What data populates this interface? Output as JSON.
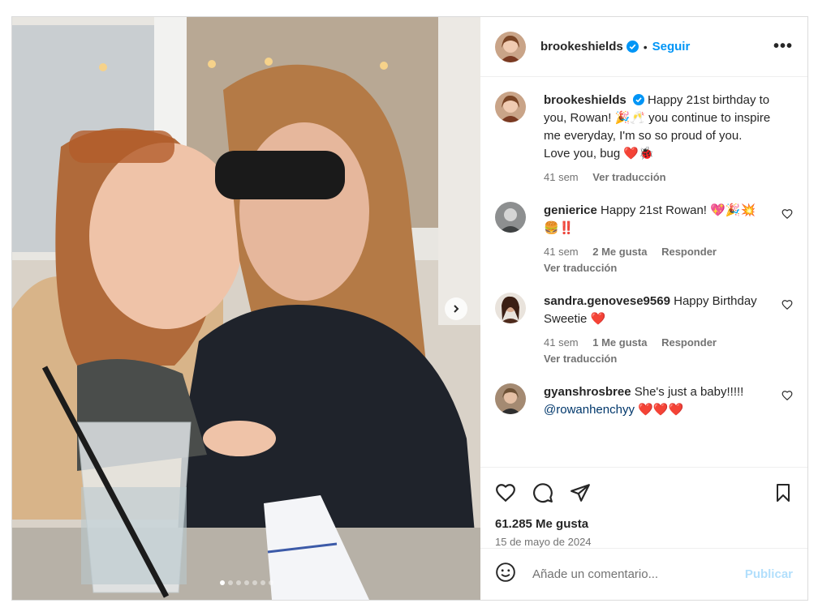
{
  "post": {
    "username": "brookeshields",
    "dot": "•",
    "follow_label": "Seguir",
    "more_label": "•••",
    "caption": {
      "text": "Happy 21st birthday to you, Rowan! 🎉🥂 you continue to inspire me everyday, I'm so so proud of you. Love you, bug ❤️🐞",
      "time": "41 sem",
      "translate": "Ver traducción"
    },
    "comments": [
      {
        "username": "genierice",
        "text": "Happy 21st Rowan! 💖🎉💥🍔‼️",
        "time": "41 sem",
        "likes": "2 Me gusta",
        "reply": "Responder",
        "translate": "Ver traducción"
      },
      {
        "username": "sandra.genovese9569",
        "text": "Happy Birthday Sweetie ❤️",
        "time": "41 sem",
        "likes": "1 Me gusta",
        "reply": "Responder",
        "translate": "Ver traducción"
      },
      {
        "username": "gyanshrosbree",
        "text": "She's just a baby!!!!!",
        "mention": "@rowanhenchyy",
        "emoji": "❤️❤️❤️"
      }
    ],
    "likes_count": "61.285 Me gusta",
    "date": "15 de mayo de 2024",
    "add_comment_placeholder": "Añade un comentario...",
    "publish_label": "Publicar",
    "carousel": {
      "total": 7,
      "active": 1
    }
  },
  "colors": {
    "accent": "#0095f6",
    "publish_disabled": "#b2dffc",
    "verified": "#0095f6",
    "text": "#262626",
    "muted": "#737373"
  },
  "icons": [
    "verified-badge-icon",
    "more-options-icon",
    "like-heart-icon",
    "comment-bubble-icon",
    "share-paper-plane-icon",
    "save-bookmark-icon",
    "emoji-smile-icon",
    "chevron-right-icon"
  ]
}
